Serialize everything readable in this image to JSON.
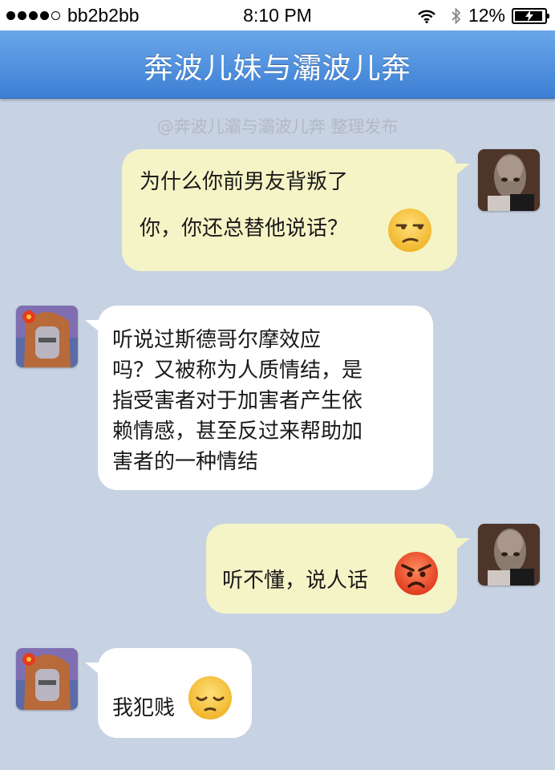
{
  "status_bar": {
    "carrier": "bb2b2bb",
    "time": "8:10 PM",
    "battery": "12%"
  },
  "nav": {
    "title": "奔波儿妹与灞波儿奔"
  },
  "watermark": "@奔波儿灞与灞波儿奔 整理发布",
  "messages": [
    {
      "side": "right",
      "lines": [
        "为什么你前男友背叛了",
        "你，你还总替他说话？"
      ],
      "emoji": "unamused-face-icon"
    },
    {
      "side": "left",
      "lines": [
        "听说过斯德哥尔摩效应",
        "吗？又被称为人质情结，是",
        "指受害者对于加害者产生依",
        "赖情感，甚至反过来帮助加",
        "害者的一种情结"
      ]
    },
    {
      "side": "right",
      "lines": [
        "听不懂，说人话"
      ],
      "emoji": "angry-face-icon"
    },
    {
      "side": "left",
      "lines": [
        "我犯贱"
      ],
      "emoji": "pensive-face-icon"
    }
  ]
}
